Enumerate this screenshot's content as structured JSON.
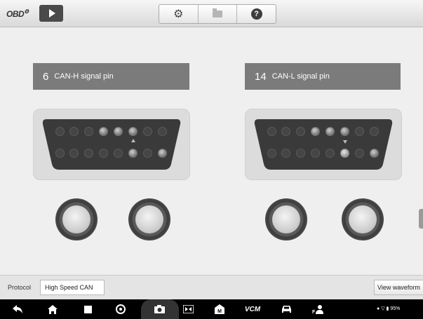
{
  "toolbar": {
    "app_label": "OBD",
    "play_icon": "play-icon",
    "buttons": [
      {
        "icon": "gear-icon"
      },
      {
        "icon": "folder-icon"
      },
      {
        "icon": "help-icon",
        "glyph": "?"
      }
    ]
  },
  "pins": [
    {
      "number": "6",
      "label": "CAN-H signal pin"
    },
    {
      "number": "14",
      "label": "CAN-L signal pin"
    }
  ],
  "protocol": {
    "label": "Protocol",
    "value": "High Speed CAN"
  },
  "actions": {
    "view_waveform": "View waveform"
  },
  "navbar": {
    "icons": [
      "back-icon",
      "home-icon",
      "recent-apps-icon",
      "browser-icon",
      "camera-icon",
      "display-icon",
      "vehicle-menu-icon",
      "vcm-icon",
      "car-icon",
      "user-switch-icon"
    ],
    "vcm_label": "VCM",
    "battery_text": "95%",
    "accent_dark": "#000000"
  }
}
